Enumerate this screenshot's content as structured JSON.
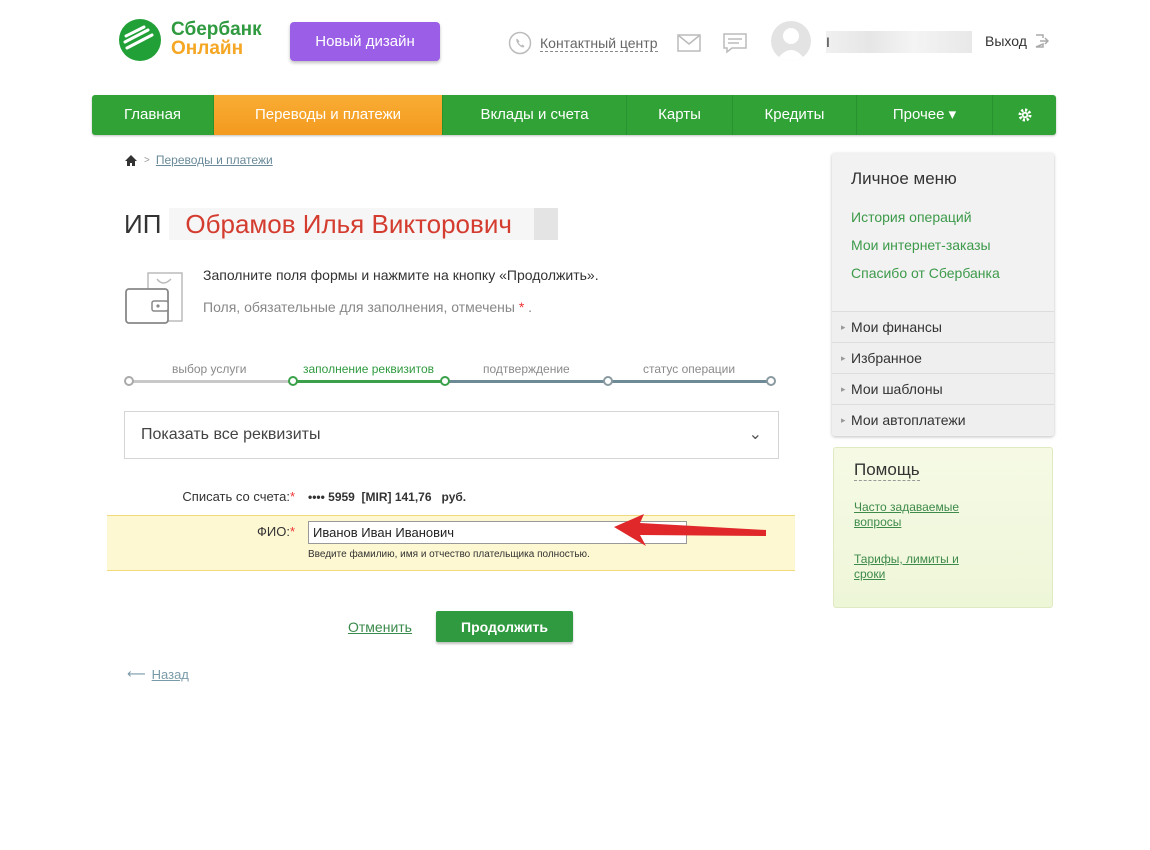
{
  "header": {
    "logo_line1": "Сбербанк",
    "logo_line2": "Онлайн",
    "new_design": "Новый дизайн",
    "contact_center": "Контактный центр",
    "user_initial": "I",
    "logout": "Выход"
  },
  "nav": {
    "items": [
      "Главная",
      "Переводы и платежи",
      "Вклады и счета",
      "Карты",
      "Кредиты",
      "Прочее ▾"
    ],
    "active_index": 1
  },
  "breadcrumb": {
    "item": "Переводы и платежи"
  },
  "title": {
    "prefix": "ИП",
    "name": "Обрамов Илья Викторович"
  },
  "instructions": {
    "line1": "Заполните поля формы и нажмите на кнопку «Продолжить».",
    "line2": "Поля, обязательные для заполнения, отмечены",
    "star": "*",
    "dot": "."
  },
  "steps": {
    "labels": [
      "выбор услуги",
      "заполнение реквизитов",
      "подтверждение",
      "статус операции"
    ],
    "active_index": 1
  },
  "form": {
    "show_all": "Показать все реквизиты",
    "debit_label": "Списать со счета:",
    "debit_value": "•••• 5959  [MIR] 141,76   руб.",
    "fio_label": "ФИО:",
    "fio_value": "Иванов Иван Иванович",
    "fio_hint": "Введите фамилию, имя и отчество плательщика полностью.",
    "required_mark": "*"
  },
  "actions": {
    "cancel": "Отменить",
    "continue": "Продолжить",
    "back": "Назад"
  },
  "personal_menu": {
    "title": "Личное меню",
    "links": [
      "История операций",
      "Мои интернет-заказы",
      "Спасибо от Сбербанка"
    ],
    "sections": [
      "Мои финансы",
      "Избранное",
      "Мои шаблоны",
      "Мои автоплатежи"
    ]
  },
  "help": {
    "title": "Помощь",
    "links": [
      "Часто задаваемые вопросы",
      "Тарифы, лимиты и сроки"
    ]
  },
  "colors": {
    "brand_green": "#31a336",
    "active_orange": "#f39a1f",
    "new_design_purple": "#9b5ee6",
    "title_red": "#d43c2f",
    "arrow_red": "#e0282a"
  }
}
